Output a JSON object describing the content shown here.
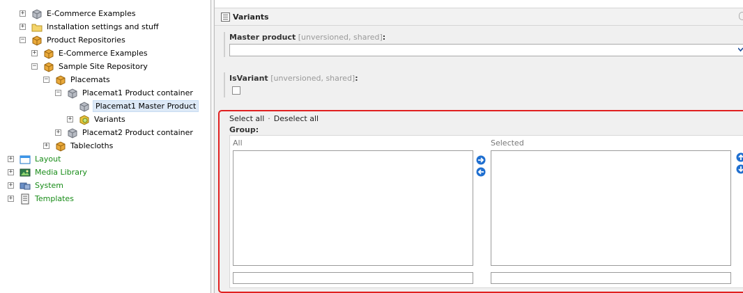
{
  "tree": {
    "items": [
      {
        "label": "E-Commerce Examples",
        "expander": "+",
        "icon": "box-silver-icon"
      },
      {
        "label": "Installation settings and stuff",
        "expander": "+",
        "icon": "folder-icon"
      },
      {
        "label": "Product Repositories",
        "expander": "-",
        "icon": "box-orange-icon"
      },
      {
        "label": "E-Commerce Examples",
        "expander": "+",
        "icon": "box-orange-icon"
      },
      {
        "label": "Sample Site Repository",
        "expander": "-",
        "icon": "box-orange-icon"
      },
      {
        "label": "Placemats",
        "expander": "-",
        "icon": "box-orange-icon"
      },
      {
        "label": "Placemat1 Product container",
        "expander": "-",
        "icon": "box-silver-icon"
      },
      {
        "label": "Placemat1 Master Product",
        "expander": "",
        "icon": "box-silver-icon",
        "selected": true
      },
      {
        "label": "Variants",
        "expander": "+",
        "icon": "box-gear-icon"
      },
      {
        "label": "Placemat2 Product container",
        "expander": "+",
        "icon": "box-silver-icon"
      },
      {
        "label": "Tablecloths",
        "expander": "+",
        "icon": "box-orange-icon"
      },
      {
        "label": "Layout",
        "expander": "+",
        "icon": "layout-icon"
      },
      {
        "label": "Media Library",
        "expander": "+",
        "icon": "media-library-icon"
      },
      {
        "label": "System",
        "expander": "+",
        "icon": "system-icon"
      },
      {
        "label": "Templates",
        "expander": "+",
        "icon": "templates-icon"
      }
    ]
  },
  "editor": {
    "section_title": "Variants",
    "master_product": {
      "label": "Master product",
      "meta": "[unversioned, shared]",
      "suffix": ":",
      "value": ""
    },
    "is_variant": {
      "label": "IsVariant",
      "meta": "[unversioned, shared]",
      "suffix": ":",
      "checked": false
    },
    "select_all": "Select all",
    "separator": "·",
    "deselect_all": "Deselect all",
    "group_label": "Group:",
    "all_header": "All",
    "selected_header": "Selected"
  },
  "colors": {
    "highlight": "#e02020",
    "green_label": "#188c18",
    "button_blue": "#1f6fd0"
  }
}
